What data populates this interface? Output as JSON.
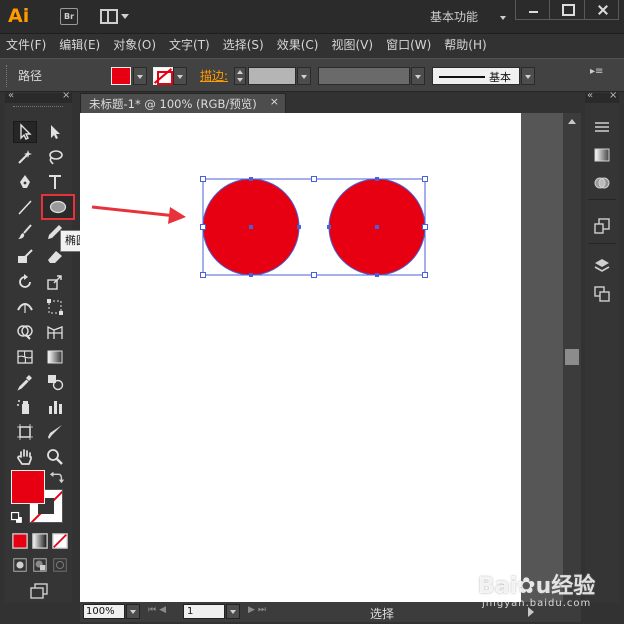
{
  "app": {
    "logo": "Ai",
    "bridge_label": "Br",
    "workspace": "基本功能"
  },
  "menu": [
    "文件(F)",
    "编辑(E)",
    "对象(O)",
    "文字(T)",
    "选择(S)",
    "效果(C)",
    "视图(V)",
    "窗口(W)",
    "帮助(H)"
  ],
  "control": {
    "selection_type": "路径",
    "fill_color": "#e60012",
    "stroke_label": "描边:",
    "brush_label": "基本"
  },
  "document": {
    "tab_title": "未标题-1* @ 100% (RGB/预览)",
    "close": "×"
  },
  "tools": {
    "tooltip": "椭圆工具 (L)",
    "active_tool": "ellipse-tool"
  },
  "status": {
    "zoom": "100%",
    "artboard": "1",
    "mode": "选择"
  },
  "canvas": {
    "shape_fill": "#e60012",
    "selection_color": "#4a5fd8",
    "annotation_arrow_color": "#e8323a"
  },
  "watermark": {
    "brand_a": "Bai",
    "brand_b": "u",
    "brand_c": "经验",
    "sub": "jingyan.baidu.com"
  }
}
